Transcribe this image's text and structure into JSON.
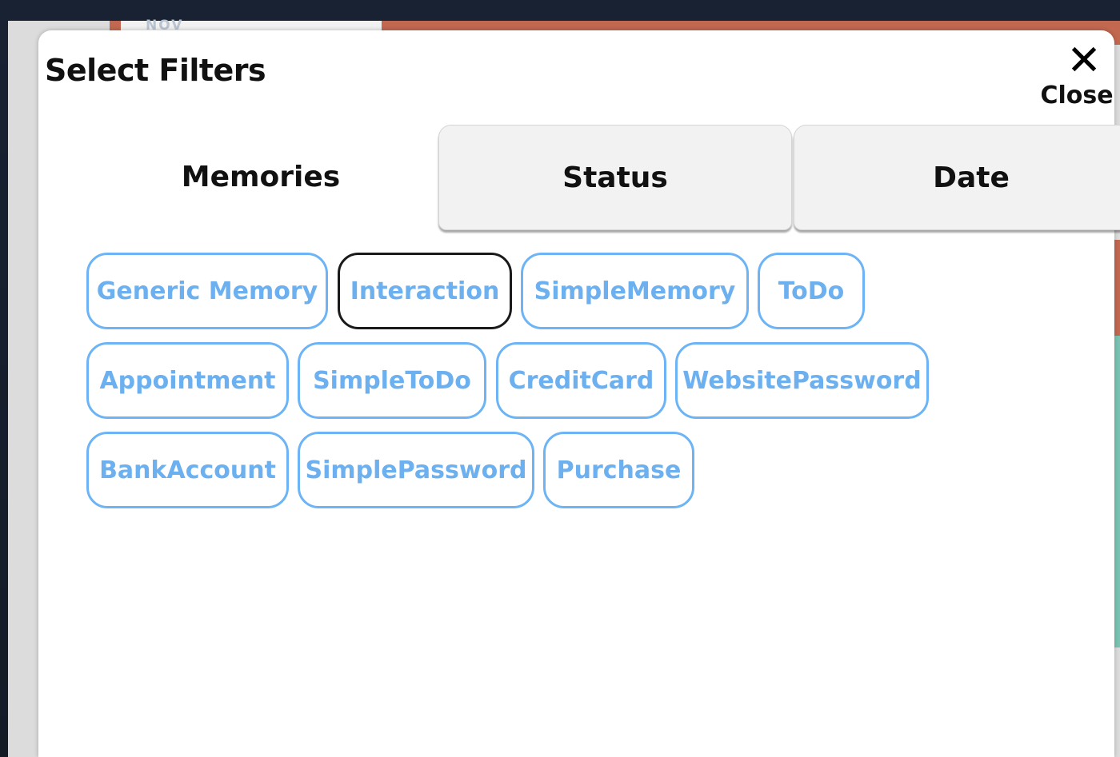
{
  "background": {
    "card_month": "NOV"
  },
  "modal": {
    "title": "Select Filters",
    "close_label": "Close",
    "close_icon": "close-icon"
  },
  "tabs": [
    {
      "label": "Memories",
      "active": true
    },
    {
      "label": "Status",
      "active": false
    },
    {
      "label": "Date",
      "active": false
    }
  ],
  "filters": [
    {
      "label": "Generic Memory",
      "selected": false
    },
    {
      "label": "Interaction",
      "selected": true
    },
    {
      "label": "SimpleMemory",
      "selected": false
    },
    {
      "label": "ToDo",
      "selected": false
    },
    {
      "label": "Appointment",
      "selected": false
    },
    {
      "label": "SimpleToDo",
      "selected": false
    },
    {
      "label": "CreditCard",
      "selected": false
    },
    {
      "label": "WebsitePassword",
      "selected": false
    },
    {
      "label": "BankAccount",
      "selected": false
    },
    {
      "label": "SimplePassword",
      "selected": false
    },
    {
      "label": "Purchase",
      "selected": false
    }
  ],
  "colors": {
    "chip_border": "#6cb4f5",
    "chip_text": "#6cb0f0",
    "chip_selected_border": "#1a1a1a",
    "banner": "#c26850"
  }
}
